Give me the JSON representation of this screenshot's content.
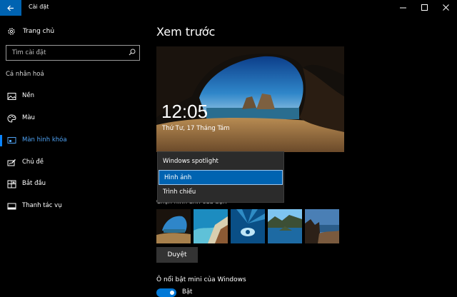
{
  "window": {
    "title": "Cài đặt",
    "icons": {
      "back": "back-arrow-icon",
      "minimize": "minimize-icon",
      "maximize": "maximize-icon",
      "close": "close-icon"
    }
  },
  "sidebar": {
    "home_label": "Trang chủ",
    "search_placeholder": "Tìm cài đặt",
    "section_title": "Cá nhân hoá",
    "items": [
      {
        "label": "Nền",
        "icon": "picture-icon"
      },
      {
        "label": "Màu",
        "icon": "palette-icon"
      },
      {
        "label": "Màn hình khóa",
        "icon": "lock-screen-icon",
        "active": true
      },
      {
        "label": "Chủ đề",
        "icon": "themes-icon"
      },
      {
        "label": "Bắt đầu",
        "icon": "start-icon"
      },
      {
        "label": "Thanh tác vụ",
        "icon": "taskbar-icon"
      }
    ]
  },
  "main": {
    "heading": "Xem trước",
    "preview": {
      "time": "12:05",
      "date": "Thứ Tư, 17 Tháng Tám"
    },
    "background_dropdown": {
      "options": [
        "Windows spotlight",
        "Hình ảnh",
        "Trình chiếu"
      ],
      "selected": "Hình ảnh"
    },
    "choose_picture_label": "Chọn hình ảnh của bạn",
    "thumbnails": [
      "cave-beach",
      "coast-aerial",
      "underwater",
      "lake-island",
      "rock-shore"
    ],
    "browse_label": "Duyệt",
    "tile_label": "Ô nổi bật mini của Windows",
    "toggle": {
      "on": true,
      "label": "Bật"
    }
  },
  "colors": {
    "accent": "#0063b1",
    "active_text": "#4fa3f5",
    "toggle_on": "#0078d7"
  }
}
